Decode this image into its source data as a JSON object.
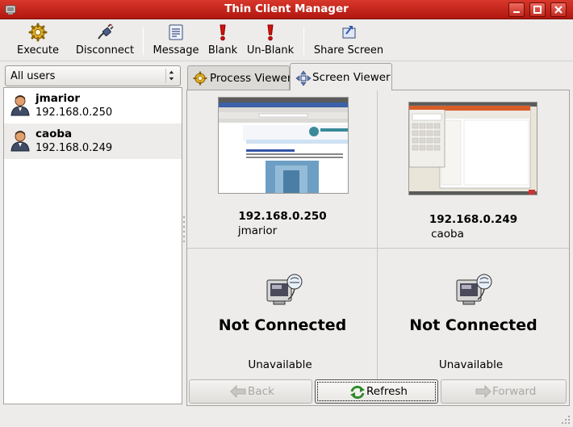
{
  "window": {
    "title": "Thin Client Manager"
  },
  "toolbar": {
    "execute_label": "Execute",
    "disconnect_label": "Disconnect",
    "message_label": "Message",
    "blank_label": "Blank",
    "unblank_label": "Un-Blank",
    "share_label": "Share Screen"
  },
  "sidebar": {
    "filter_value": "All users",
    "users": [
      {
        "name": "jmarior",
        "ip": "192.168.0.250"
      },
      {
        "name": "caoba",
        "ip": "192.168.0.249"
      }
    ]
  },
  "tabs": [
    {
      "label": "Process Viewer",
      "icon": "gear-icon",
      "active": false
    },
    {
      "label": "Screen Viewer",
      "icon": "move-arrows-icon",
      "active": true
    }
  ],
  "screens": [
    {
      "ip": "192.168.0.250",
      "user": "jmarior",
      "status": "connected"
    },
    {
      "ip": "192.168.0.249",
      "user": "caoba",
      "status": "connected"
    },
    {
      "status_label": "Not Connected",
      "detail": "Unavailable"
    },
    {
      "status_label": "Not Connected",
      "detail": "Unavailable"
    }
  ],
  "buttons": {
    "back_label": "Back",
    "refresh_label": "Refresh",
    "forward_label": "Forward"
  },
  "colors": {
    "titlebar": "#c2231a",
    "selected_row": "#edeceb",
    "blank_icon": "#d0120c"
  }
}
